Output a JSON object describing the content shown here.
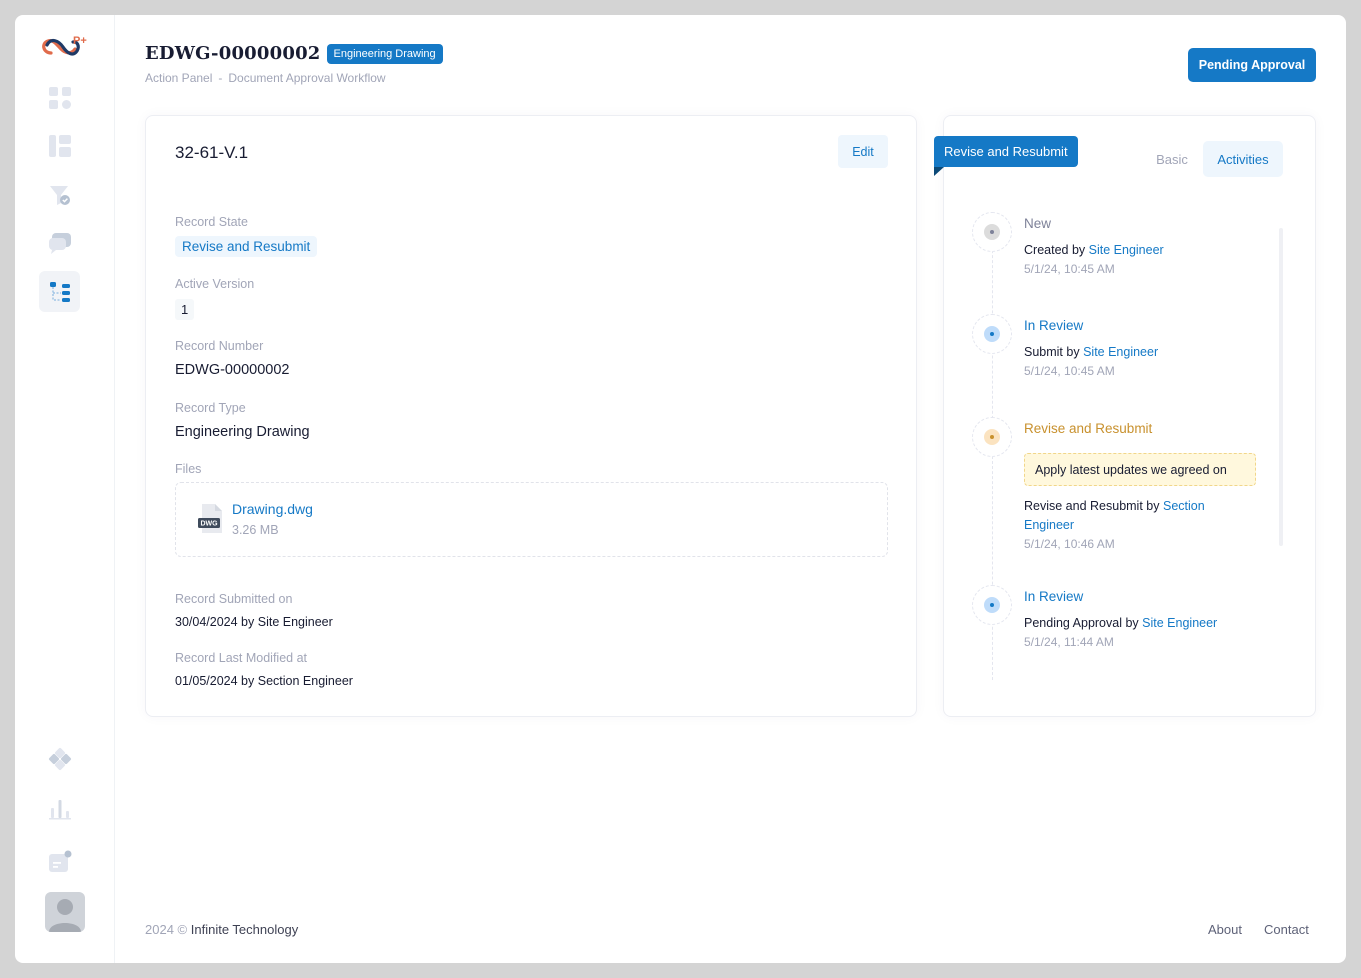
{
  "app": {
    "brand": "P+"
  },
  "header": {
    "title": "EDWG-00000002",
    "type_badge": "Engineering Drawing",
    "breadcrumb": [
      "Action Panel",
      "-",
      "Document Approval Workflow"
    ],
    "status_button": "Pending Approval"
  },
  "record": {
    "title": "32-61-V.1",
    "edit_label": "Edit",
    "state_label": "Record State",
    "state_value": "Revise and Resubmit",
    "version_label": "Active Version",
    "version_value": "1",
    "number_label": "Record Number",
    "number_value": "EDWG-00000002",
    "type_label": "Record Type",
    "type_value": "Engineering Drawing",
    "files_label": "Files",
    "file": {
      "name": "Drawing.dwg",
      "size": "3.26 MB",
      "ext": "DWG"
    },
    "submitted_label": "Record Submitted on",
    "submitted_date": "30/04/2024",
    "submitted_by_word": "by",
    "submitted_by": "Site Engineer",
    "modified_label": "Record Last Modified at",
    "modified_date": "01/05/2024",
    "modified_by_word": "by",
    "modified_by": "Section Engineer"
  },
  "activity_panel": {
    "ribbon": "Revise and Resubmit",
    "tabs": {
      "basic": "Basic",
      "activities": "Activities"
    },
    "items": [
      {
        "title": "New",
        "action": "Created",
        "by": "by",
        "user": "Site Engineer",
        "time": "5/1/24, 10:45 AM"
      },
      {
        "title": "In Review",
        "action": "Submit",
        "by": "by",
        "user": "Site Engineer",
        "time": "5/1/24, 10:45 AM"
      },
      {
        "title": "Revise and Resubmit",
        "note": "Apply latest updates we agreed on",
        "action": "Revise and Resubmit",
        "by": "by",
        "user": "Section Engineer",
        "time": "5/1/24, 10:46 AM"
      },
      {
        "title": "In Review",
        "action": "Pending Approval",
        "by": "by",
        "user": "Site Engineer",
        "time": "5/1/24, 11:44 AM"
      }
    ]
  },
  "footer": {
    "year": "2024 ©",
    "company": "Infinite Technology",
    "about": "About",
    "contact": "Contact"
  },
  "colors": {
    "primary": "#1579c6",
    "warning": "#c8912e",
    "muted": "#a1a5b7"
  }
}
